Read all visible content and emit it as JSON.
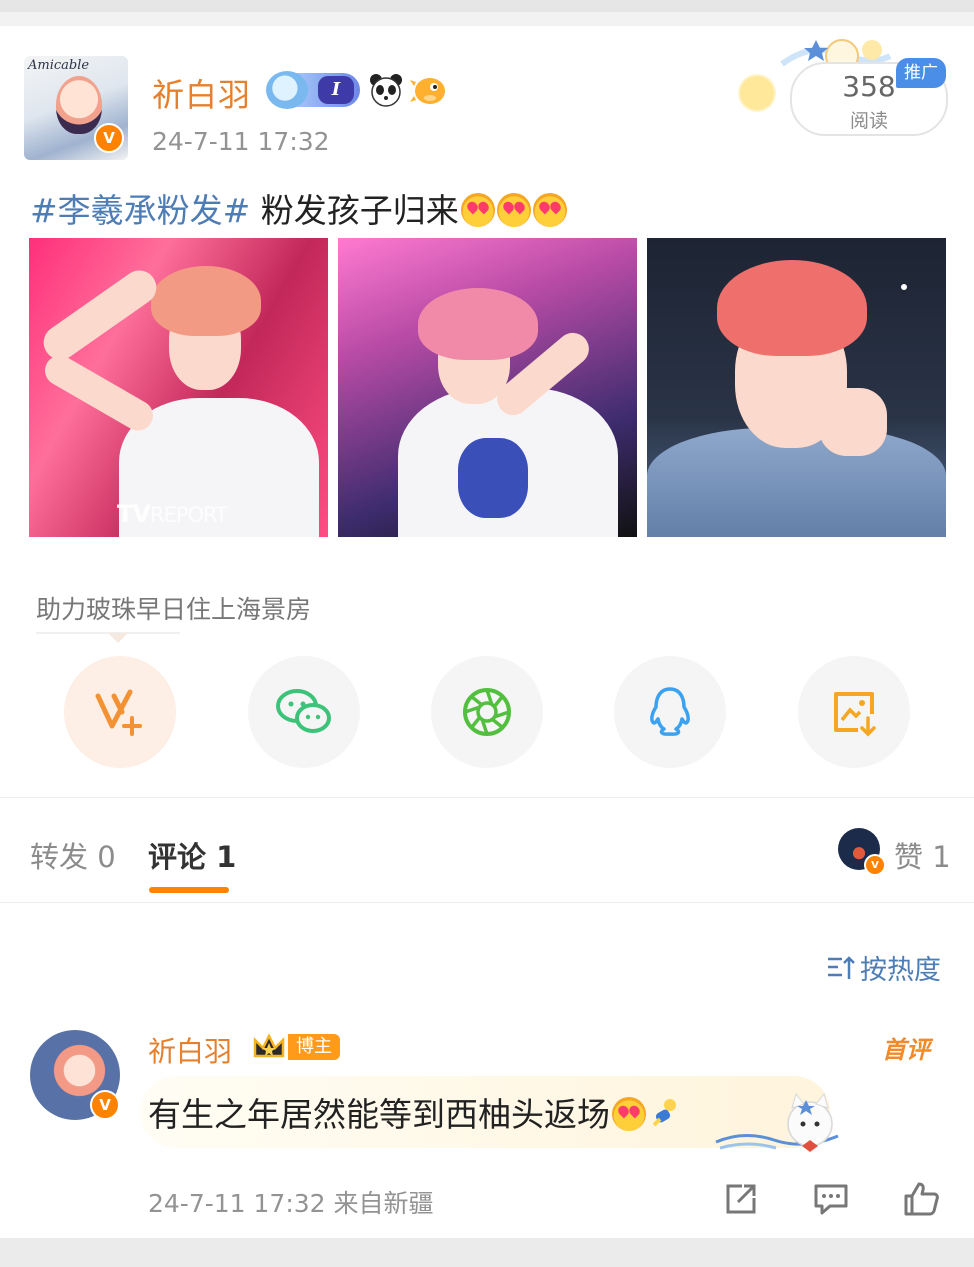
{
  "post": {
    "author": "祈白羽",
    "level_badge": "I",
    "timestamp": "24-7-11 17:32",
    "avatar_script": "Amicable",
    "verified_mark": "V",
    "read_count": "358",
    "read_label": "阅读",
    "promo_tag": "推广",
    "hashtag": "#李羲承粉发#",
    "text": " 粉发孩子归来",
    "photo_watermark": "TV",
    "photo_watermark_rest": "REPORT"
  },
  "share": {
    "help_text": "助力玻珠早日住上海景房",
    "buttons": [
      {
        "icon": "v-plus-icon"
      },
      {
        "icon": "wechat-icon"
      },
      {
        "icon": "moments-icon"
      },
      {
        "icon": "qq-icon"
      },
      {
        "icon": "save-image-icon"
      }
    ]
  },
  "tabs": {
    "repost": "转发 0",
    "comment": "评论 1",
    "like": "赞 1"
  },
  "sort": {
    "label": "按热度"
  },
  "comment": {
    "author": "祈白羽",
    "host_tag": "博主",
    "first_badge": "首评",
    "text": "有生之年居然能等到西柚头返场",
    "meta": "24-7-11 17:32  来自新疆"
  },
  "colors": {
    "accent": "#ff8200",
    "username": "#e5802e",
    "link": "#4e7db6"
  }
}
